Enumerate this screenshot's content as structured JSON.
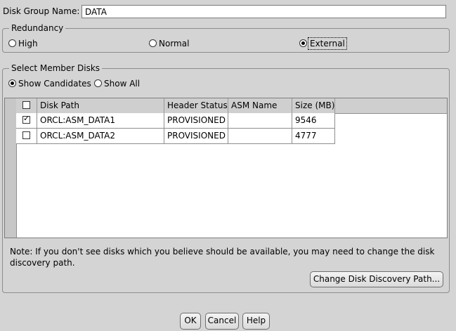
{
  "disk_group": {
    "label": "Disk Group Name:",
    "value": "DATA"
  },
  "redundancy": {
    "legend": "Redundancy",
    "options": [
      {
        "label": "High",
        "selected": false
      },
      {
        "label": "Normal",
        "selected": false
      },
      {
        "label": "External",
        "selected": true
      }
    ]
  },
  "member_disks": {
    "legend": "Select Member Disks",
    "filter_options": [
      {
        "label": "Show Candidates",
        "selected": true
      },
      {
        "label": "Show All",
        "selected": false
      }
    ],
    "columns": [
      "Disk Path",
      "Header Status",
      "ASM Name",
      "Size (MB)"
    ],
    "rows": [
      {
        "checked": true,
        "disk_path": "ORCL:ASM_DATA1",
        "header_status": "PROVISIONED",
        "asm_name": "",
        "size_mb": "9546"
      },
      {
        "checked": false,
        "disk_path": "ORCL:ASM_DATA2",
        "header_status": "PROVISIONED",
        "asm_name": "",
        "size_mb": "4777"
      }
    ],
    "note": "Note: If you don't see disks which you believe should be available, you may need to change the disk discovery path.",
    "change_path_button": "Change Disk Discovery Path..."
  },
  "footer": {
    "ok": "OK",
    "cancel": "Cancel",
    "help": "Help"
  }
}
